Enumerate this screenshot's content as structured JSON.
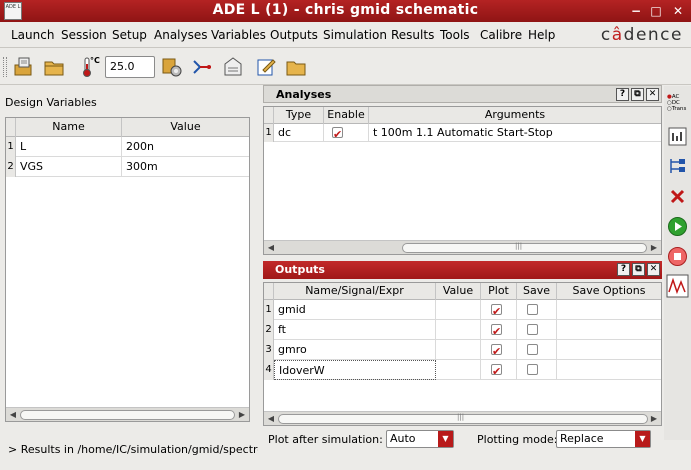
{
  "window": {
    "title": "ADE L (1) - chris gmid schematic",
    "app_icon_text": "ADE L",
    "minimize": "−",
    "maximize": "□",
    "close": "✕"
  },
  "menu": [
    "Launch",
    "Session",
    "Setup",
    "Analyses",
    "Variables",
    "Outputs",
    "Simulation",
    "Results",
    "Tools",
    "Calibre",
    "Help"
  ],
  "logo": {
    "pre": "c",
    "dot": "â",
    "post": "dence"
  },
  "toolbar": {
    "temperature_unit": "°C",
    "temperature": "25.0"
  },
  "design_variables": {
    "label": "Design Variables",
    "columns": [
      "Name",
      "Value"
    ],
    "rows": [
      {
        "num": "1",
        "name": "L",
        "value": "200n"
      },
      {
        "num": "2",
        "name": "VGS",
        "value": "300m"
      }
    ]
  },
  "analyses": {
    "title": "Analyses",
    "columns": [
      "Type",
      "Enable",
      "Arguments"
    ],
    "rows": [
      {
        "num": "1",
        "type": "dc",
        "enabled": true,
        "arguments": "t 100m 1.1 Automatic Start-Stop"
      }
    ]
  },
  "outputs": {
    "title": "Outputs",
    "columns": [
      "Name/Signal/Expr",
      "Value",
      "Plot",
      "Save",
      "Save Options"
    ],
    "rows": [
      {
        "num": "1",
        "name": "gmid",
        "value": "",
        "plot": true,
        "save": false
      },
      {
        "num": "2",
        "name": "ft",
        "value": "",
        "plot": true,
        "save": false
      },
      {
        "num": "3",
        "name": "gmro",
        "value": "",
        "plot": true,
        "save": false
      },
      {
        "num": "4",
        "name": "IdoverW",
        "value": "",
        "plot": true,
        "save": false
      }
    ]
  },
  "panel_buttons": {
    "help": "?",
    "float": "⧉",
    "close": "✕"
  },
  "scroll_grip": "|||",
  "bottom": {
    "plot_after_label": "Plot after simulation:",
    "plot_after_value": "Auto",
    "plotting_mode_label": "Plotting mode:",
    "plotting_mode_value": "Replace"
  },
  "status": "> Results in /home/IC/simulation/gmid/spectre/",
  "sidebar": {
    "ac_label": "AC",
    "dc_label": "DC",
    "trans_label": "Trans"
  },
  "colors": {
    "accent": "#b81a1a",
    "run_green": "#2fa12f",
    "stop_red": "#d33"
  }
}
